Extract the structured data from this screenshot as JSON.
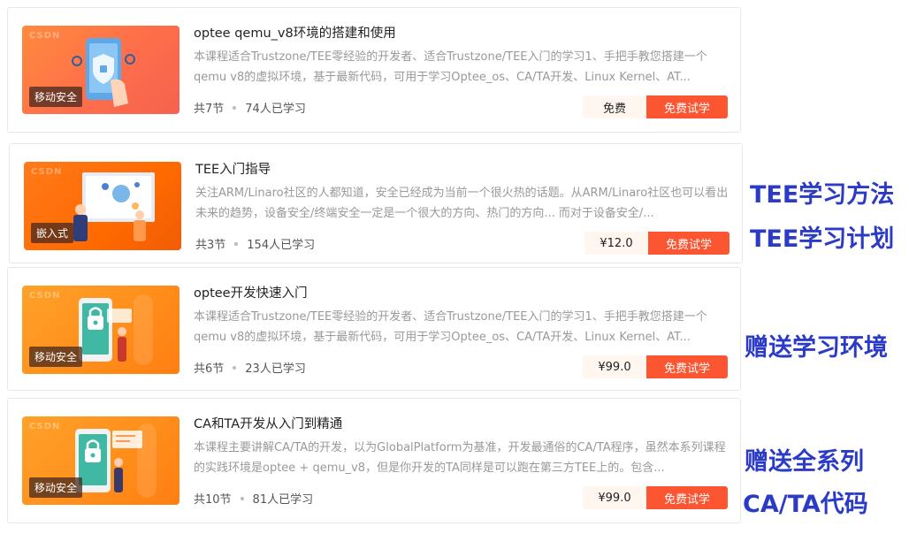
{
  "courses": [
    {
      "title": "optee qemu_v8环境的搭建和使用",
      "description": "本课程适合Trustzone/TEE零经验的开发者、适合Trustzone/TEE入门的学习1、手把手教您搭建一个qemu v8的虚拟环境，基于最新代码，可用于学习Optee_os、CA/TA开发、Linux Kernel、AT...",
      "tag": "移动安全",
      "lessons": "共7节",
      "learners": "74人已学习",
      "price": "免费",
      "trial": "免费试学",
      "brand": "CSDN"
    },
    {
      "title": "TEE入门指导",
      "description": "关注ARM/Linaro社区的人都知道，安全已经成为当前一个很火热的话题。从ARM/Linaro社区也可以看出未来的趋势，设备安全/终端安全一定是一个很大的方向、热门的方向... 而对于设备安全/...",
      "tag": "嵌入式",
      "lessons": "共3节",
      "learners": "154人已学习",
      "price": "¥12.0",
      "trial": "免费试学",
      "brand": "CSDN"
    },
    {
      "title": "optee开发快速入门",
      "description": "本课程适合Trustzone/TEE零经验的开发者、适合Trustzone/TEE入门的学习1、手把手教您搭建一个qemu v8的虚拟环境，基于最新代码，可用于学习Optee_os、CA/TA开发、Linux Kernel、AT...",
      "tag": "移动安全",
      "lessons": "共6节",
      "learners": "23人已学习",
      "price": "¥99.0",
      "trial": "免费试学",
      "brand": "CSDN"
    },
    {
      "title": "CA和TA开发从入门到精通",
      "description": "本课程主要讲解CA/TA的开发，以为GlobalPlatform为基准，开发最通俗的CA/TA程序，虽然本系列课程的实践环境是optee + qemu_v8，但是你开发的TA同样是可以跑在第三方TEE上的。包含...",
      "tag": "移动安全",
      "lessons": "共10节",
      "learners": "81人已学习",
      "price": "¥99.0",
      "trial": "免费试学",
      "brand": "CSDN"
    }
  ],
  "side_notes": [
    "TEE学习方法",
    "TEE学习计划",
    "赠送学习环境",
    "赠送全系列",
    "CA/TA代码"
  ],
  "colors": {
    "accent": "#fc5531",
    "side_text": "#2b3bc7",
    "price_bg": "#fff6ef"
  }
}
